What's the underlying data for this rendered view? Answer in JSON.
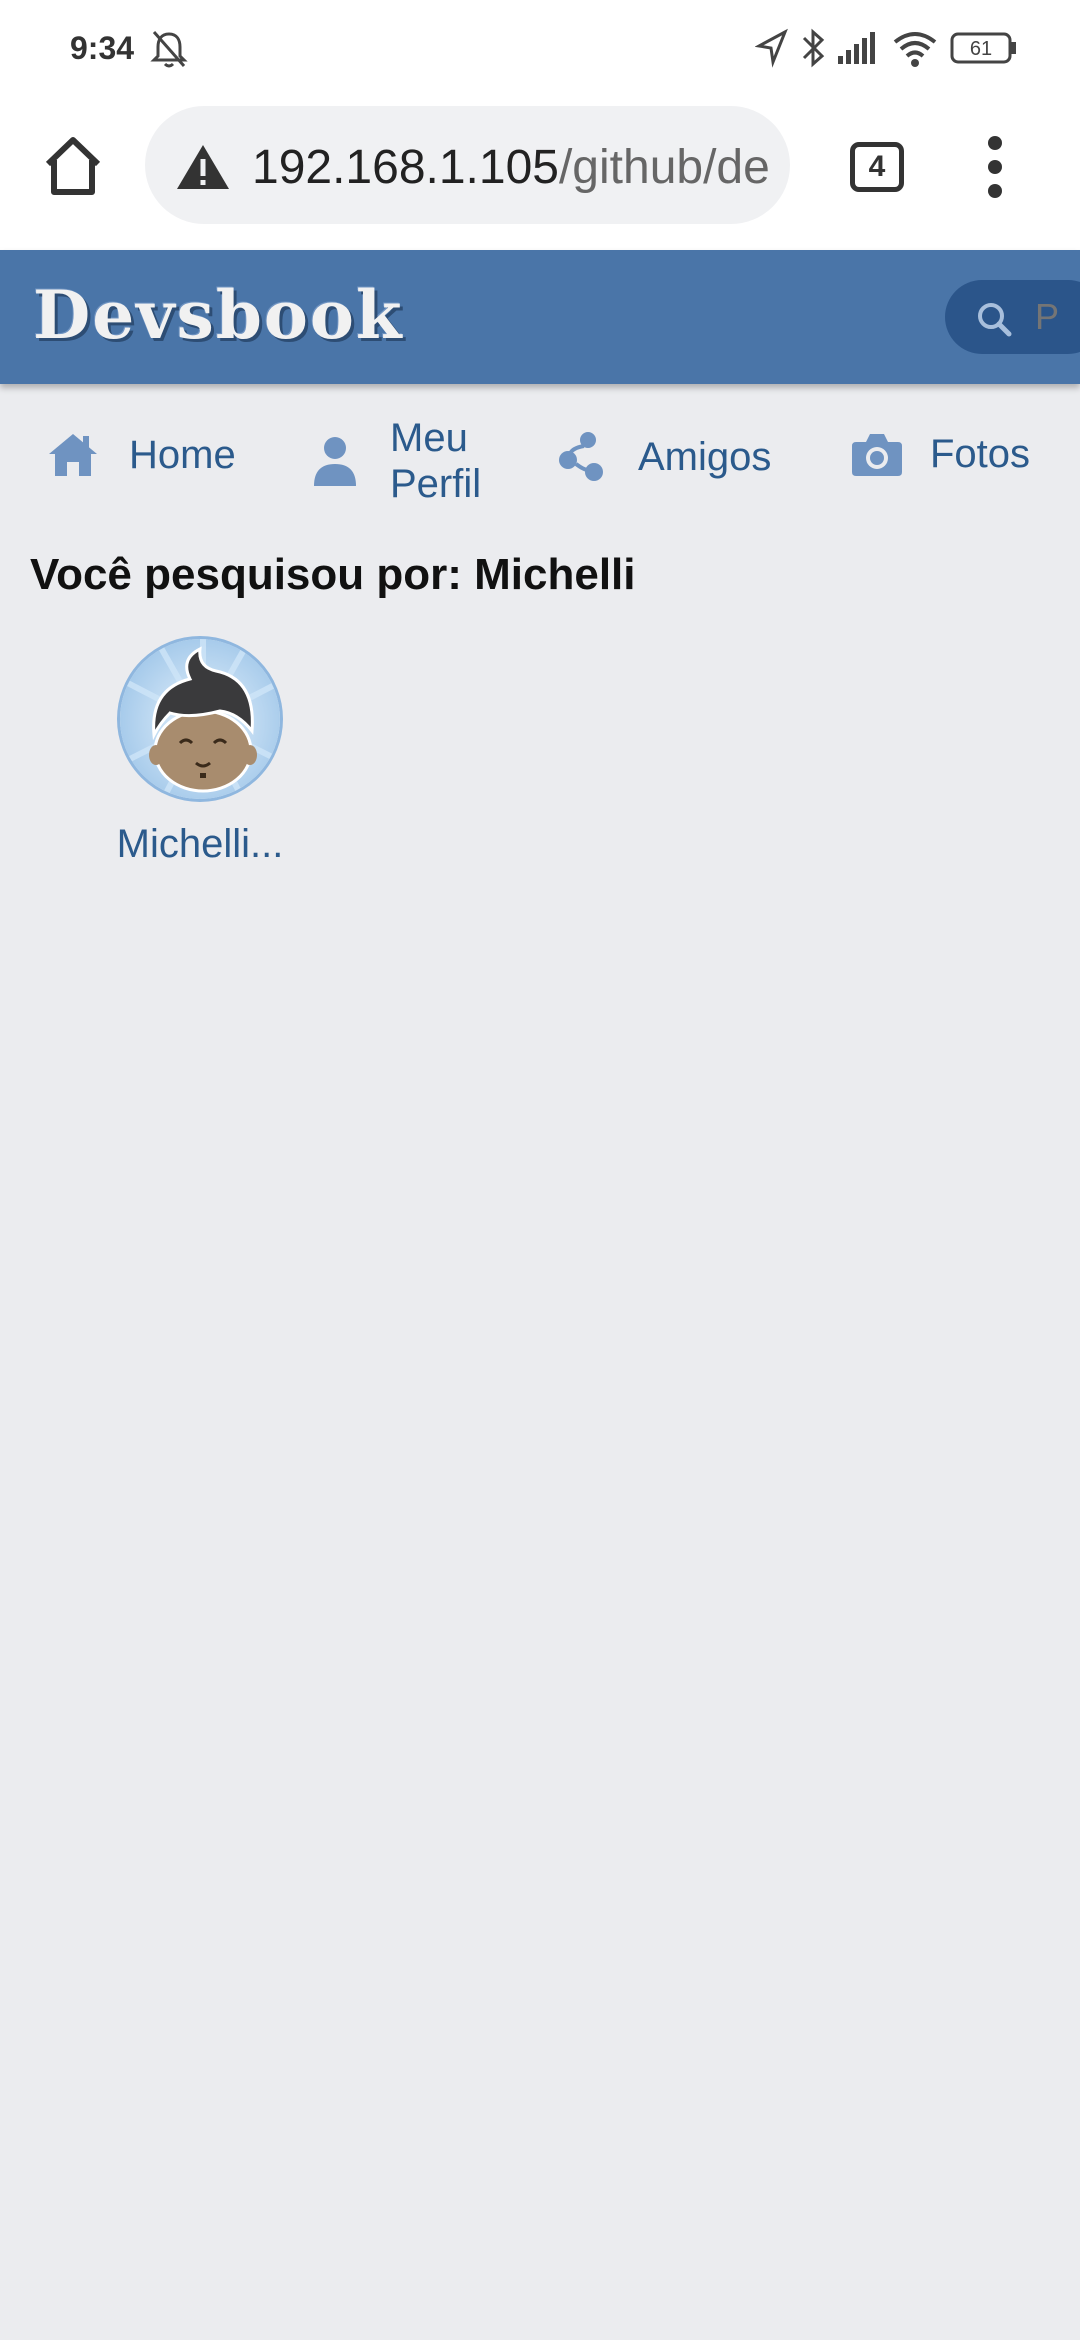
{
  "status_bar": {
    "time": "9:34",
    "battery": "61",
    "icons": [
      "mute-icon",
      "location-icon",
      "bluetooth-icon",
      "signal-icon",
      "wifi-icon",
      "battery-icon"
    ]
  },
  "browser": {
    "url_host": "192.168.1.105",
    "url_path": "/github/de",
    "tab_count": "4"
  },
  "header": {
    "logo": "Devsbook",
    "search_placeholder": "P"
  },
  "nav": {
    "home": "Home",
    "profile_line1": "Meu",
    "profile_line2": "Perfil",
    "friends": "Amigos",
    "photos": "Fotos"
  },
  "main": {
    "search_title": "Você pesquisou por: Michelli",
    "results": [
      {
        "name": "Michelli..."
      }
    ]
  },
  "colors": {
    "header_bg": "#4a75a8",
    "page_bg": "#ebecef",
    "link": "#2b5a8c",
    "nav_icon": "#6f93c1"
  }
}
